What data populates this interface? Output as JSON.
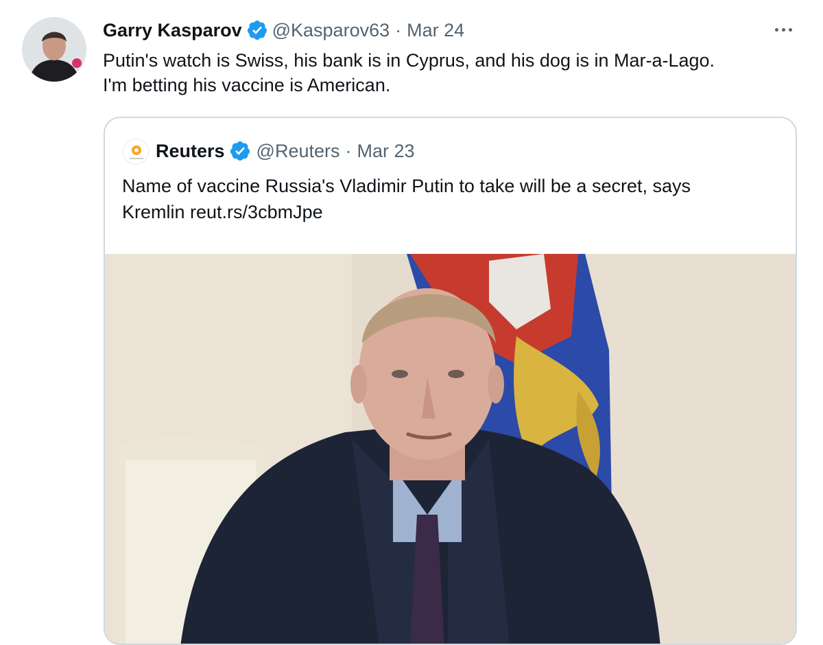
{
  "tweet": {
    "author_name": "Garry Kasparov",
    "author_handle": "@Kasparov63",
    "separator": "·",
    "date": "Mar 24",
    "text_lines": [
      "Putin's watch is Swiss, his bank is in Cyprus, and his dog is in Mar-a-Lago.",
      "I'm betting his vaccine is American."
    ],
    "avatar_icon": "user-avatar-photo",
    "more_icon": "more-options-icon"
  },
  "quoted_tweet": {
    "author_name": "Reuters",
    "author_handle": "@Reuters",
    "separator": "·",
    "date": "Mar 23",
    "text_lines": [
      "Name of vaccine Russia's Vladimir Putin to take will be a secret, says"
    ],
    "text_line2_prefix": "Kremlin ",
    "link_text": "reut.rs/3cbmJpe",
    "avatar_icon": "reuters-logo",
    "media_icon": "news-photo"
  },
  "colors": {
    "verified_blue": "#1d9bf0",
    "secondary_text": "#536471",
    "border": "#cfd9de",
    "reuters_orange": "#f6a623"
  }
}
